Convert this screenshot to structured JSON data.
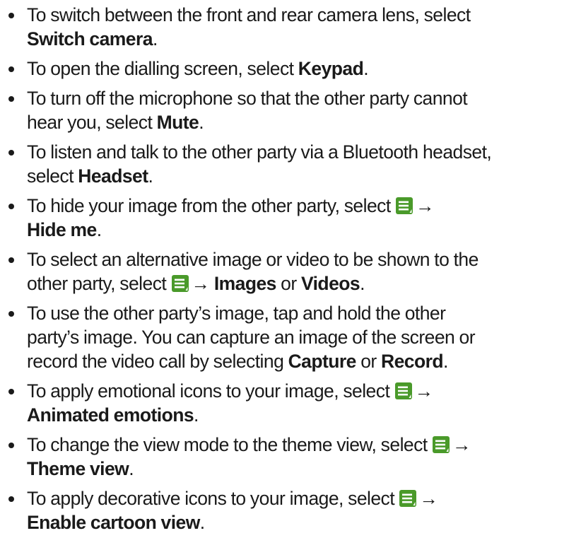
{
  "items": [
    {
      "line1": "To switch between the front and rear camera lens, select",
      "bold": "Switch camera",
      "end": "."
    },
    {
      "pre": "To open the dialling screen, select ",
      "bold": "Keypad",
      "end": "."
    },
    {
      "line1": "To turn off the microphone so that the other party cannot",
      "pre": "hear you, select ",
      "bold": "Mute",
      "end": "."
    },
    {
      "line1": "To listen and talk to the other party via a Bluetooth headset,",
      "pre": "select ",
      "bold": "Headset",
      "end": "."
    },
    {
      "pre": "To hide your image from the other party, select ",
      "arrow": "→",
      "bold": "Hide me",
      "end": "."
    },
    {
      "line1": "To select an alternative image or video to be shown to the",
      "pre": "other party, select ",
      "arrow": "→",
      "bold1": "Images",
      "or": "or",
      "bold2": "Videos",
      "end": "."
    },
    {
      "line1": "To use the other party’s image, tap and hold the other",
      "line2": "party’s image. You can capture an image of the screen or",
      "pre": "record the video call by selecting ",
      "bold1": "Capture",
      "or": "or",
      "bold2": "Record",
      "end": "."
    },
    {
      "pre": "To apply emotional icons to your image, select ",
      "arrow": "→",
      "bold": "Animated emotions",
      "end": "."
    },
    {
      "pre": "To change the view mode to the theme view, select ",
      "arrow": "→",
      "bold": "Theme view",
      "end": "."
    },
    {
      "pre": "To apply decorative icons to your image, select ",
      "arrow": "→",
      "bold": "Enable cartoon view",
      "end": "."
    }
  ],
  "icons": {
    "menu": "menu-icon",
    "menu_color": "#4a9a2a"
  }
}
